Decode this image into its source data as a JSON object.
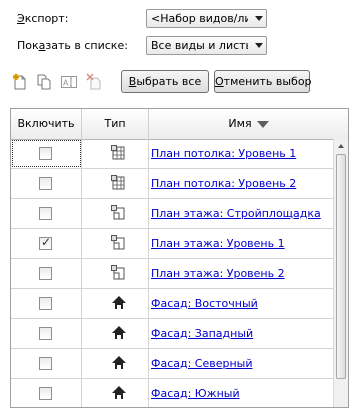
{
  "export": {
    "label": "Экспорт:",
    "value": "<Набор видов/листов>"
  },
  "show_in_list": {
    "label": "Показать в списке:",
    "value": "Все виды и листы в модели"
  },
  "toolbar": {
    "icons": [
      "new-set-icon",
      "duplicate-set-icon",
      "rename-set-icon",
      "delete-set-icon"
    ],
    "select_all": "Выбрать все",
    "deselect": "Отменить выбор"
  },
  "table": {
    "headers": {
      "include": "Включить",
      "type": "Тип",
      "name": "Имя"
    },
    "rows": [
      {
        "checked": false,
        "type_icon": "ceiling-plan-icon",
        "name": "План потолка: Уровень 1"
      },
      {
        "checked": false,
        "type_icon": "ceiling-plan-icon",
        "name": "План потолка: Уровень 2"
      },
      {
        "checked": false,
        "type_icon": "floor-plan-icon",
        "name": "План этажа: Стройплощадка"
      },
      {
        "checked": true,
        "type_icon": "floor-plan-icon",
        "name": "План этажа: Уровень 1"
      },
      {
        "checked": false,
        "type_icon": "floor-plan-icon",
        "name": "План этажа: Уровень 2"
      },
      {
        "checked": false,
        "type_icon": "elevation-icon",
        "name": "Фасад: Восточный"
      },
      {
        "checked": false,
        "type_icon": "elevation-icon",
        "name": "Фасад: Западный"
      },
      {
        "checked": false,
        "type_icon": "elevation-icon",
        "name": "Фасад: Северный"
      },
      {
        "checked": false,
        "type_icon": "elevation-icon",
        "name": "Фасад: Южный"
      }
    ]
  },
  "colors": {
    "link": "#0000cc",
    "header_bg": "#ececec",
    "grid_line": "#d4d4d4"
  }
}
